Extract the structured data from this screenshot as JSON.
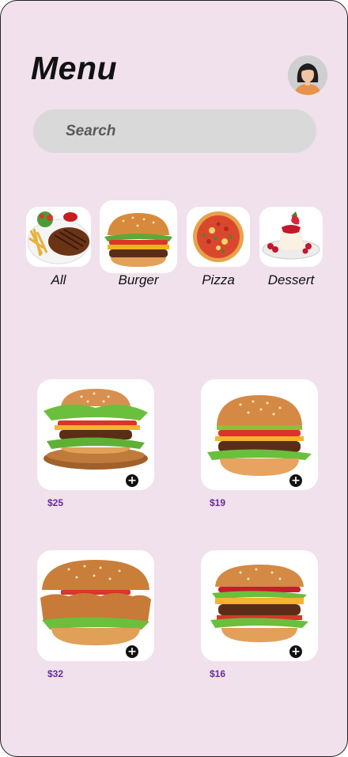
{
  "header": {
    "title": "Menu"
  },
  "search": {
    "placeholder": "Search"
  },
  "categories": [
    {
      "label": "All"
    },
    {
      "label": "Burger"
    },
    {
      "label": "Pizza"
    },
    {
      "label": "Dessert"
    }
  ],
  "products": [
    {
      "price": "$25"
    },
    {
      "price": "$19"
    },
    {
      "price": "$32"
    },
    {
      "price": "$16"
    }
  ],
  "colors": {
    "background": "#f0e1ec",
    "search_bg": "#d9d9d9",
    "price": "#6b2aa0"
  }
}
